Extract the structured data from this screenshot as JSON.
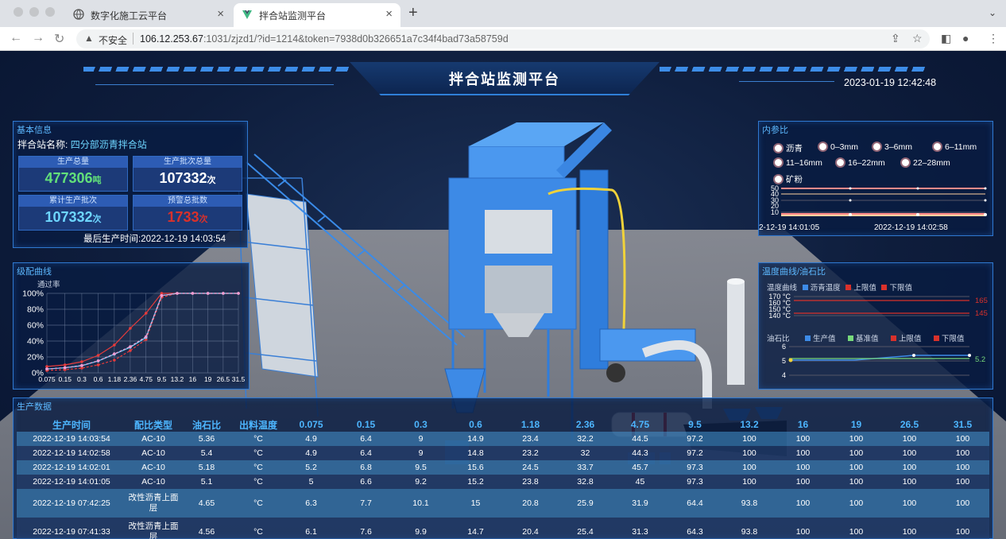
{
  "browser": {
    "tabs": [
      {
        "title": "数字化施工云平台",
        "active": false
      },
      {
        "title": "拌合站监测平台",
        "active": true
      }
    ],
    "new_tab": "+",
    "address": {
      "security_label": "不安全",
      "host": "106.12.253.67",
      "rest": ":1031/zjzd1/?id=1214&token=7938d0b326651a7c34f4bad73a58759d"
    }
  },
  "header": {
    "title": "拌合站监测平台",
    "datetime": "2023-01-19 12:42:48"
  },
  "basic_info": {
    "title": "基本信息",
    "station_label": "拌合站名称:",
    "station_name": "四分部沥青拌合站",
    "stats": [
      {
        "label": "生产总量",
        "value": "477306",
        "unit": "吨",
        "color": "#62e07a"
      },
      {
        "label": "生产批次总量",
        "value": "107332",
        "unit": "次",
        "color": "#ffffff"
      },
      {
        "label": "累计生产批次",
        "value": "107332",
        "unit": "次",
        "color": "#6ed6ff"
      },
      {
        "label": "预警总批数",
        "value": "1733",
        "unit": "次",
        "color": "#d9312b"
      }
    ],
    "last_time_label": "最后生产时间:",
    "last_time": "2022-12-19 14:03:54"
  },
  "grading": {
    "title": "级配曲线",
    "ylabel": "通过率"
  },
  "ratio": {
    "title": "内参比",
    "legend": [
      "沥青",
      "0–3mm",
      "3–6mm",
      "6–11mm",
      "11–16mm",
      "16–22mm",
      "22–28mm",
      "矿粉"
    ],
    "ticks": [
      "50",
      "40",
      "30",
      "20",
      "10"
    ],
    "x_labels": [
      "2-12-19 14:01:05",
      "2022-12-19 14:02:58"
    ]
  },
  "temperature": {
    "title": "温度曲线/油石比",
    "temp_legend_label": "温度曲线",
    "temp_legend": [
      "沥青温度",
      "上限值",
      "下限值"
    ],
    "temp_ticks": [
      "170 °C",
      "160 °C",
      "150 °C",
      "140 °C"
    ],
    "temp_values": [
      "165",
      "145"
    ],
    "oil_legend_label": "油石比",
    "oil_legend": [
      "生产值",
      "基准值",
      "上限值",
      "下限值"
    ],
    "oil_ticks": [
      "6",
      "5",
      "4"
    ],
    "oil_value": "5.2",
    "legend_colors": [
      "#3d8be8",
      "#d9312b",
      "#d9312b",
      "#3d8be8",
      "#77d97b",
      "#d9312b",
      "#d9312b"
    ]
  },
  "production": {
    "title": "生产数据",
    "headers": [
      "生产时间",
      "配比类型",
      "油石比",
      "出料温度",
      "0.075",
      "0.15",
      "0.3",
      "0.6",
      "1.18",
      "2.36",
      "4.75",
      "9.5",
      "13.2",
      "16",
      "19",
      "26.5",
      "31.5"
    ],
    "rows": [
      [
        "2022-12-19 14:03:54",
        "AC-10",
        "5.36",
        "°C",
        "4.9",
        "6.4",
        "9",
        "14.9",
        "23.4",
        "32.2",
        "44.5",
        "97.2",
        "100",
        "100",
        "100",
        "100",
        "100"
      ],
      [
        "2022-12-19 14:02:58",
        "AC-10",
        "5.4",
        "°C",
        "4.9",
        "6.4",
        "9",
        "14.8",
        "23.2",
        "32",
        "44.3",
        "97.2",
        "100",
        "100",
        "100",
        "100",
        "100"
      ],
      [
        "2022-12-19 14:02:01",
        "AC-10",
        "5.18",
        "°C",
        "5.2",
        "6.8",
        "9.5",
        "15.6",
        "24.5",
        "33.7",
        "45.7",
        "97.3",
        "100",
        "100",
        "100",
        "100",
        "100"
      ],
      [
        "2022-12-19 14:01:05",
        "AC-10",
        "5.1",
        "°C",
        "5",
        "6.6",
        "9.2",
        "15.2",
        "23.8",
        "32.8",
        "45",
        "97.3",
        "100",
        "100",
        "100",
        "100",
        "100"
      ],
      [
        "2022-12-19 07:42:25",
        "改性沥青上面层",
        "4.65",
        "°C",
        "6.3",
        "7.7",
        "10.1",
        "15",
        "20.8",
        "25.9",
        "31.9",
        "64.4",
        "93.8",
        "100",
        "100",
        "100",
        "100"
      ],
      [
        "2022-12-19 07:41:33",
        "改性沥青上面层",
        "4.56",
        "°C",
        "6.1",
        "7.6",
        "9.9",
        "14.7",
        "20.4",
        "25.4",
        "31.3",
        "64.3",
        "93.8",
        "100",
        "100",
        "100",
        "100"
      ]
    ]
  },
  "chart_data": [
    {
      "type": "line",
      "title": "级配曲线",
      "ylabel": "通过率",
      "x": [
        "0.075",
        "0.15",
        "0.3",
        "0.6",
        "1.18",
        "2.36",
        "4.75",
        "9.5",
        "13.2",
        "16",
        "19",
        "26.5",
        "31.5"
      ],
      "yticks": [
        "100%",
        "80%",
        "60%",
        "40%",
        "20%",
        "0%"
      ],
      "ylim": [
        0,
        100
      ],
      "series": [
        {
          "color": "#e83b3b",
          "values": [
            8,
            10,
            14,
            22,
            35,
            56,
            75,
            100,
            100,
            100,
            100,
            100,
            100
          ]
        },
        {
          "color": "#e83b3b",
          "values": [
            3,
            4,
            6,
            10,
            16,
            28,
            42,
            95,
            100,
            100,
            100,
            100,
            100
          ]
        },
        {
          "color": "#6ed6ff",
          "values": [
            4.9,
            6.4,
            9,
            14.9,
            23.4,
            32.2,
            44.5,
            97.2,
            100,
            100,
            100,
            100,
            100
          ]
        },
        {
          "color": "#f29bd2",
          "values": [
            5,
            6.5,
            9.3,
            15.2,
            23.9,
            33,
            45.5,
            97.3,
            100,
            100,
            100,
            100,
            100
          ]
        }
      ]
    }
  ]
}
